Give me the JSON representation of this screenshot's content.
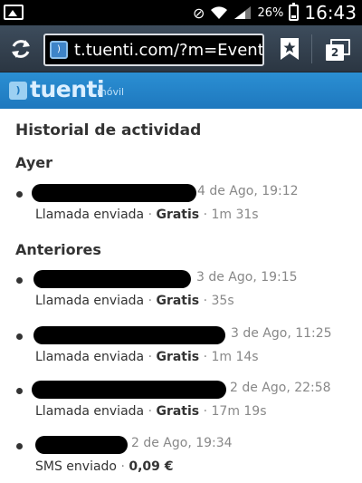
{
  "status_bar": {
    "battery": "26%",
    "time": "16:43"
  },
  "browser": {
    "url": "t.tuenti.com/?m=Eventl",
    "tab_count": "2"
  },
  "brand": {
    "name": "tuenti",
    "subtitle": "móvil"
  },
  "page": {
    "title": "Historial de actividad",
    "sections": [
      {
        "header": "Ayer",
        "entries": [
          {
            "date": "4 de Ago, 19:12",
            "type": "Llamada enviada",
            "price": "Gratis",
            "duration": "1m 31s"
          }
        ]
      },
      {
        "header": "Anteriores",
        "entries": [
          {
            "date": "3 de Ago, 19:15",
            "type": "Llamada enviada",
            "price": "Gratis",
            "duration": "35s"
          },
          {
            "date": "3 de Ago, 11:25",
            "type": "Llamada enviada",
            "price": "Gratis",
            "duration": "1m 14s"
          },
          {
            "date": "2 de Ago, 22:58",
            "type": "Llamada enviada",
            "price": "Gratis",
            "duration": "17m 19s"
          },
          {
            "date": "2 de Ago, 19:34",
            "type": "SMS enviado",
            "price": "0,09 €",
            "duration": ""
          }
        ]
      }
    ]
  },
  "separator": "·",
  "colors": {
    "brand_blue": "#1e78be",
    "toolbar": "#2b3642",
    "redaction": "#000000"
  }
}
